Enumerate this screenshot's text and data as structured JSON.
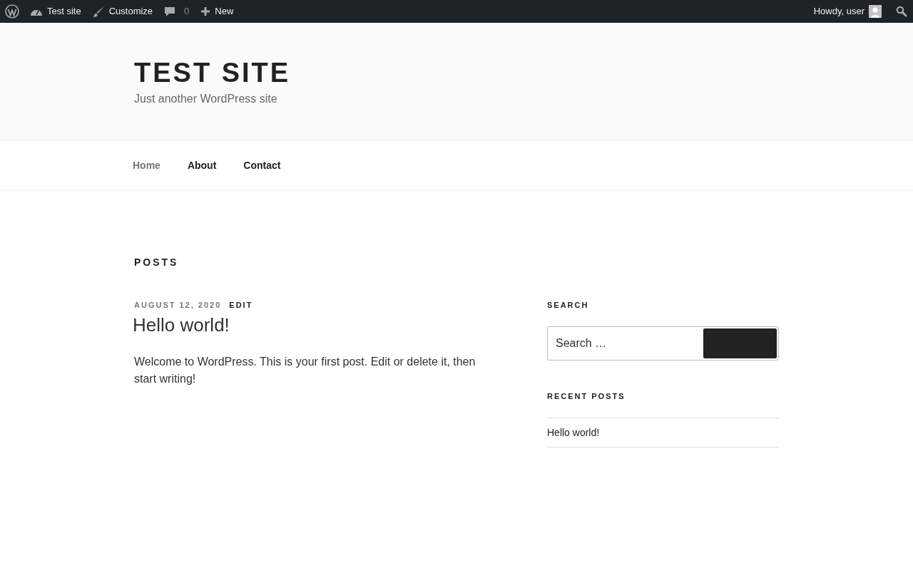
{
  "admin_bar": {
    "items": [
      {
        "kind": "logo"
      },
      {
        "kind": "dashboard",
        "label": "Test site"
      },
      {
        "kind": "customize",
        "label": "Customize"
      },
      {
        "kind": "comments",
        "label": "0"
      },
      {
        "kind": "new",
        "label": "New"
      }
    ],
    "greeting": "Howdy, user"
  },
  "header": {
    "site_title": "TEST SITE",
    "tagline": "Just another WordPress site"
  },
  "nav": [
    {
      "label": "Home",
      "selected": true
    },
    {
      "label": "About",
      "selected": false
    },
    {
      "label": "Contact",
      "selected": false
    }
  ],
  "page_title": "POSTS",
  "posts": [
    {
      "date": "AUGUST 12, 2020",
      "edit": "EDIT",
      "title": "Hello world!",
      "excerpt": "Welcome to WordPress. This is your first post. Edit or delete it, then start writing!"
    }
  ],
  "sidebar": {
    "search_heading": "SEARCH",
    "search_placeholder": "Search …",
    "recent_heading": "RECENT POSTS",
    "recent_posts": [
      "Hello world!"
    ]
  }
}
